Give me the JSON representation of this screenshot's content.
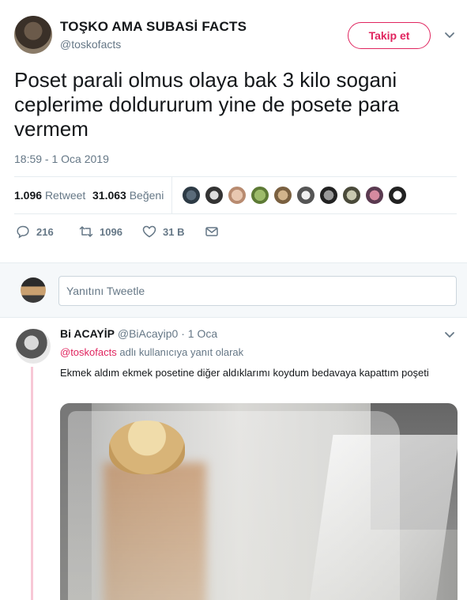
{
  "tweet": {
    "author_name": "TOŞKO AMA SUBASİ FACTS",
    "author_handle": "@toskofacts",
    "follow_label": "Takip et",
    "text": "Poset parali olmus olaya bak 3 kilo sogani ceplerime doldururum yine de posete para vermem",
    "timestamp": "18:59 - 1 Oca 2019",
    "retweet_count": "1.096",
    "retweet_label": "Retweet",
    "like_count": "31.063",
    "like_label": "Beğeni",
    "actions": {
      "reply_count": "216",
      "retweet_count": "1096",
      "like_count": "31 B"
    },
    "icons": [
      "chevron-down-icon",
      "reply-icon",
      "retweet-icon",
      "heart-icon",
      "envelope-icon"
    ],
    "accent_color": "#e0245e"
  },
  "reply_box": {
    "placeholder": "Yanıtını Tweetle"
  },
  "reply": {
    "name": "Bi ACAYİP",
    "handle": "@BiAcayip0",
    "date": "· 1 Oca",
    "replying_mention": "@toskofacts",
    "replying_suffix": "adlı kullanıcıya yanıt olarak",
    "text": "Ekmek aldım ekmek posetine diğer aldıklarımı  koydum bedavaya kapattım poşeti"
  }
}
